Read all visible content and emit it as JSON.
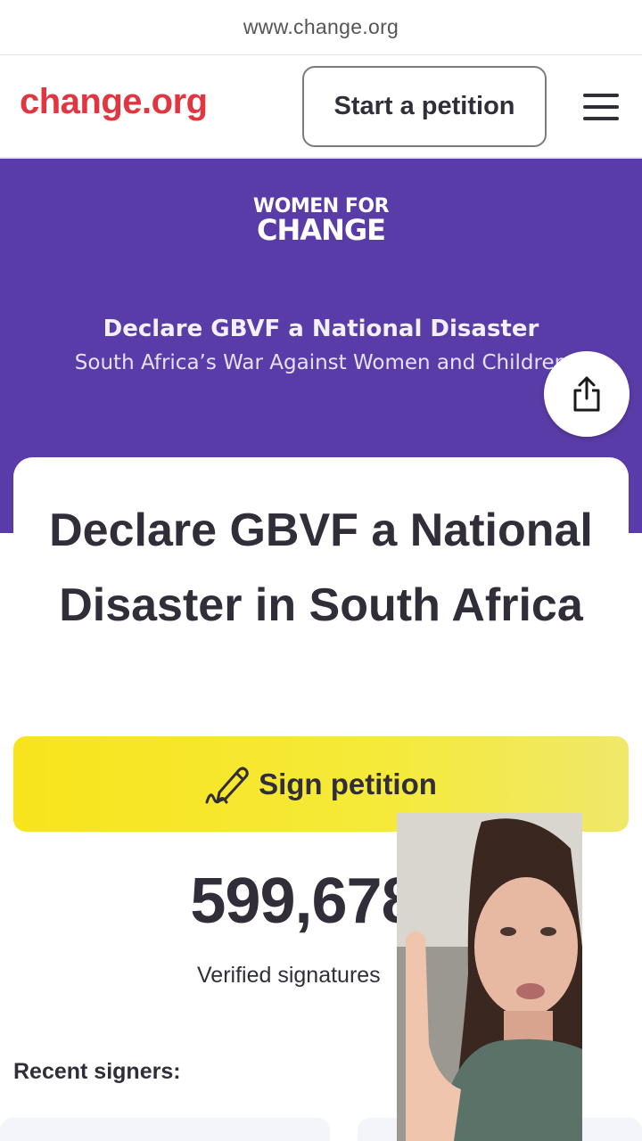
{
  "browser": {
    "url": "www.change.org"
  },
  "header": {
    "logo": "change.org",
    "start_petition": "Start a petition"
  },
  "hero": {
    "brand_line1": "WOMEN FOR",
    "brand_line2": "CHANGE",
    "title": "Declare GBVF a National Disaster",
    "subtitle": "South Africa’s War Against Women and Children"
  },
  "petition": {
    "title": "Declare GBVF a National Disaster in South Africa",
    "sign_label": "Sign petition",
    "signature_count": "599,678",
    "signatures_label": "Verified signatures",
    "recent_signers": "Recent signers:"
  },
  "colors": {
    "brand_red": "#e1353f",
    "hero_purple": "#5a3ca8",
    "sign_yellow": "#f8e41c",
    "text": "#312e3a",
    "verified_blue": "#3b6ff5"
  },
  "icons": [
    "share-icon",
    "menu-icon",
    "pen-icon",
    "verified-badge-icon",
    "chevron-down-icon"
  ]
}
